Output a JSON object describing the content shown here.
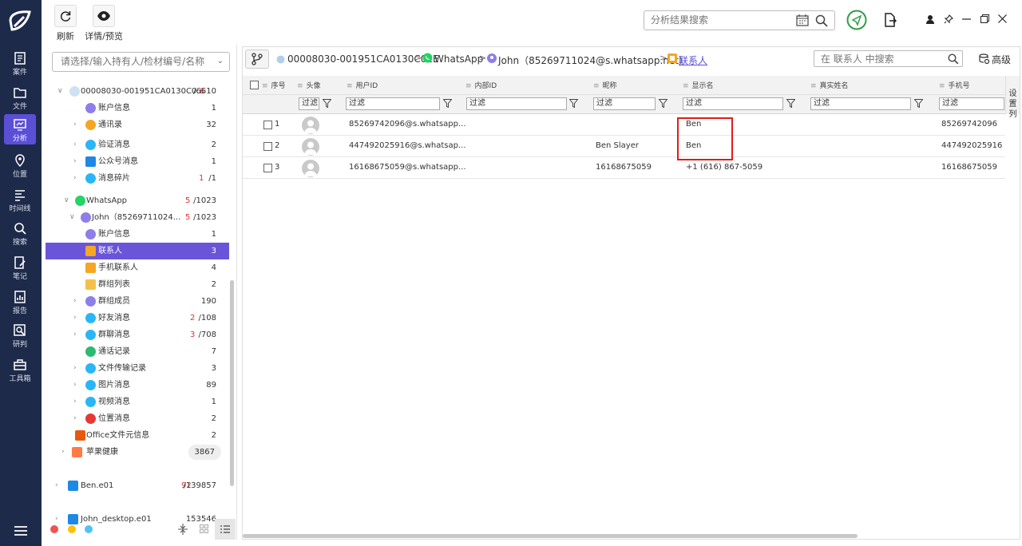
{
  "nav": {
    "items": [
      {
        "label": "案件",
        "icon": "case-icon"
      },
      {
        "label": "文件",
        "icon": "folder-icon"
      },
      {
        "label": "分析",
        "icon": "analysis-icon",
        "active": true
      },
      {
        "label": "位置",
        "icon": "location-icon"
      },
      {
        "label": "时间线",
        "icon": "timeline-icon"
      },
      {
        "label": "搜索",
        "icon": "search-icon"
      },
      {
        "label": "笔记",
        "icon": "note-icon"
      },
      {
        "label": "报告",
        "icon": "report-icon"
      },
      {
        "label": "研判",
        "icon": "judge-icon"
      },
      {
        "label": "工具箱",
        "icon": "toolbox-icon"
      }
    ]
  },
  "toolbar": {
    "refresh_label": "刷新",
    "preview_label": "详情/预览",
    "search_placeholder": "分析结果搜索"
  },
  "tree": {
    "search_placeholder": "请选择/输入持有人/检材编号/名称",
    "nodes": [
      {
        "label": "00008030-001951CA0130C0...",
        "count_red": "6",
        "count": "/6610"
      },
      {
        "label": "账户信息",
        "count_red": "",
        "count": "1"
      },
      {
        "label": "通讯录",
        "count_red": "",
        "count": "32"
      },
      {
        "label": "验证消息",
        "count_red": "",
        "count": "2"
      },
      {
        "label": "公众号消息",
        "count_red": "",
        "count": "1"
      },
      {
        "label": "消息碎片",
        "count_red": "1",
        "count": "/1"
      },
      {
        "label": "WhatsApp",
        "count_red": "5",
        "count": "/1023"
      },
      {
        "label": "John（85269711024...",
        "count_red": "5",
        "count": "/1023"
      },
      {
        "label": "账户信息",
        "count_red": "",
        "count": "1"
      },
      {
        "label": "联系人",
        "count_red": "",
        "count": "3"
      },
      {
        "label": "手机联系人",
        "count_red": "",
        "count": "4"
      },
      {
        "label": "群组列表",
        "count_red": "",
        "count": "2"
      },
      {
        "label": "群组成员",
        "count_red": "",
        "count": "190"
      },
      {
        "label": "好友消息",
        "count_red": "2",
        "count": "/108"
      },
      {
        "label": "群聊消息",
        "count_red": "3",
        "count": "/708"
      },
      {
        "label": "通话记录",
        "count_red": "",
        "count": "7"
      },
      {
        "label": "文件传输记录",
        "count_red": "",
        "count": "3"
      },
      {
        "label": "图片消息",
        "count_red": "",
        "count": "89"
      },
      {
        "label": "视频消息",
        "count_red": "",
        "count": "1"
      },
      {
        "label": "位置消息",
        "count_red": "",
        "count": "2"
      },
      {
        "label": "Office文件元信息",
        "count_red": "",
        "count": "2"
      },
      {
        "label": "苹果健康",
        "count_red": "",
        "count": "3867"
      },
      {
        "label": "Ben.e01",
        "count_red": "92",
        "count": "/139857"
      },
      {
        "label": "John_desktop.e01",
        "count_red": "",
        "count": "153546"
      }
    ]
  },
  "breadcrumb": {
    "device": "00008030-001951CA0130C02E",
    "app": "WhatsApp",
    "account": "John（85269711024@s.whatsapp.net）",
    "current": "联系人"
  },
  "inner_search_placeholder": "在 联系人 中搜索",
  "advanced_label": "高级",
  "grid": {
    "headers": [
      "序号",
      "头像",
      "用户ID",
      "内部ID",
      "昵称",
      "显示名",
      "真实姓名",
      "手机号"
    ],
    "filter_label": "过滤",
    "settings_label": "设置列",
    "rows": [
      {
        "idx": "1",
        "user_id": "85269742096@s.whatsapp...",
        "internal_id": "",
        "nickname": "",
        "display_name": "Ben",
        "real_name": "",
        "phone": "85269742096"
      },
      {
        "idx": "2",
        "user_id": "447492025916@s.whatsap...",
        "internal_id": "",
        "nickname": "Ben Slayer",
        "display_name": "Ben",
        "real_name": "",
        "phone": "447492025916"
      },
      {
        "idx": "3",
        "user_id": "16168675059@s.whatsapp...",
        "internal_id": "",
        "nickname": "16168675059",
        "display_name": "+1 (616) 867-5059",
        "real_name": "",
        "phone": "16168675059"
      }
    ]
  }
}
